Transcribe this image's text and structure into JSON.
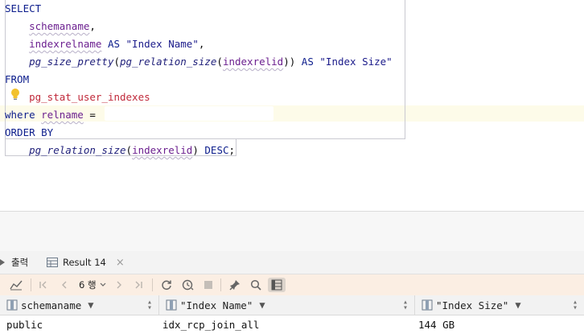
{
  "editor": {
    "lines": [
      {
        "parts": [
          {
            "t": "SELECT",
            "c": "kw"
          }
        ]
      },
      {
        "parts": [
          {
            "t": "    ",
            "c": "plain"
          },
          {
            "t": "schemaname",
            "c": "id"
          },
          {
            "t": ",",
            "c": "plain"
          }
        ]
      },
      {
        "parts": [
          {
            "t": "    ",
            "c": "plain"
          },
          {
            "t": "indexrelname",
            "c": "id"
          },
          {
            "t": " AS ",
            "c": "kw"
          },
          {
            "t": "\"Index Name\"",
            "c": "str"
          },
          {
            "t": ",",
            "c": "plain"
          }
        ]
      },
      {
        "parts": [
          {
            "t": "    ",
            "c": "plain"
          },
          {
            "t": "pg_size_pretty",
            "c": "fn"
          },
          {
            "t": "(",
            "c": "plain"
          },
          {
            "t": "pg_relation_size",
            "c": "fn"
          },
          {
            "t": "(",
            "c": "plain"
          },
          {
            "t": "indexrelid",
            "c": "id"
          },
          {
            "t": "))",
            "c": "plain"
          },
          {
            "t": " AS ",
            "c": "kw"
          },
          {
            "t": "\"Index Size\"",
            "c": "str"
          }
        ]
      },
      {
        "parts": [
          {
            "t": "FROM",
            "c": "kw"
          }
        ]
      },
      {
        "parts": [
          {
            "t": "    ",
            "c": "plain"
          },
          {
            "t": "pg_stat_user_indexes",
            "c": "tbl"
          }
        ]
      },
      {
        "parts": [
          {
            "t": "where ",
            "c": "kw"
          },
          {
            "t": "relname",
            "c": "id"
          },
          {
            "t": " =",
            "c": "plain"
          }
        ]
      },
      {
        "parts": [
          {
            "t": "ORDER BY",
            "c": "kw"
          }
        ]
      },
      {
        "parts": [
          {
            "t": "    ",
            "c": "plain"
          },
          {
            "t": "pg_relation_size",
            "c": "fn"
          },
          {
            "t": "(",
            "c": "plain"
          },
          {
            "t": "indexrelid",
            "c": "id"
          },
          {
            "t": ") ",
            "c": "plain"
          },
          {
            "t": "DESC",
            "c": "kw"
          },
          {
            "t": ";",
            "c": "plain"
          }
        ]
      }
    ]
  },
  "tabs": {
    "output_label": "출력",
    "result_label": "Result 14"
  },
  "toolbar": {
    "row_count": "6 행"
  },
  "grid": {
    "columns": [
      "schemaname",
      "\"Index Name\"",
      "\"Index Size\""
    ],
    "rows": [
      [
        "public",
        "idx_rcp_join_all",
        "144 GB"
      ]
    ]
  }
}
